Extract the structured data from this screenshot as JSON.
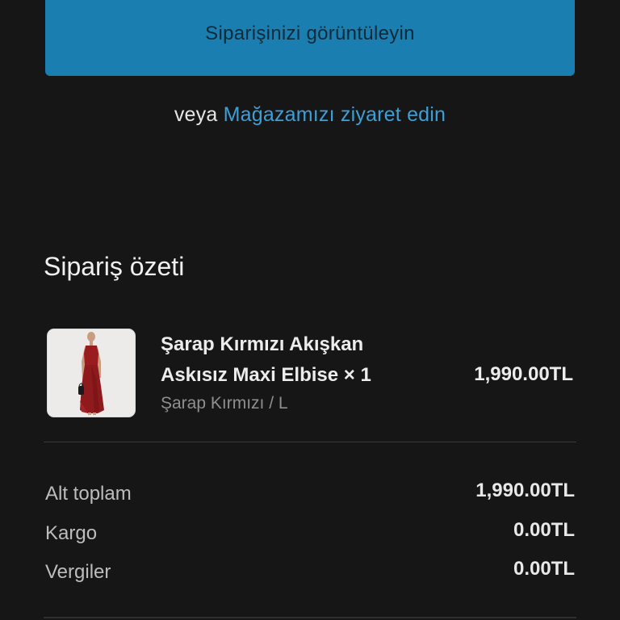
{
  "actions": {
    "view_order_label": "Siparişinizi görüntüleyin",
    "or_text": "veya",
    "visit_store_label": "Mağazamızı ziyaret edin"
  },
  "summary": {
    "title": "Sipariş özeti",
    "item": {
      "name": "Şarap Kırmızı Akışkan Askısız Maxi Elbise × 1",
      "variant": "Şarap Kırmızı / L",
      "price": "1,990.00TL",
      "image_icon": "product-photo-red-maxi-dress"
    },
    "totals": [
      {
        "label": "Alt toplam",
        "value": "1,990.00TL"
      },
      {
        "label": "Kargo",
        "value": "0.00TL"
      },
      {
        "label": "Vergiler",
        "value": "0.00TL"
      }
    ]
  },
  "colors": {
    "background": "#161616",
    "button": "#1a7fb0",
    "link": "#3c9fd8",
    "dress": "#9b1c1f"
  }
}
